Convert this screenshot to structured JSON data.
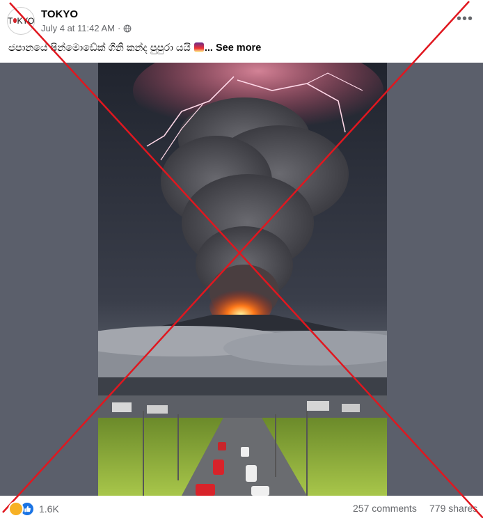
{
  "post": {
    "author": "TOKYO",
    "avatar_text_left": "T",
    "avatar_text_right": "KYO",
    "timestamp": "July 4 at 11:42 AM",
    "separator": "·",
    "audience_icon": "globe-icon",
    "more_icon": "•••",
    "caption_text": "ජපානයේ ෂින්මොඩේක් ගිනි කන්ද පුපුරා යයි",
    "caption_emoji": "volcano-emoji",
    "see_more_label": "... See more"
  },
  "image": {
    "description_icon": "volcano-eruption-photo",
    "overlay": "red-x-cross",
    "overlay_color": "#e0171f"
  },
  "engagement": {
    "reaction_count": "1.6K",
    "reaction_icons": [
      "care-reaction-icon",
      "like-reaction-icon"
    ],
    "comments_label": "257 comments",
    "shares_label": "779 shares"
  },
  "colors": {
    "text_primary": "#050505",
    "text_secondary": "#65676b",
    "like_blue": "#1b74e4",
    "media_bg": "#5b5f6b"
  }
}
